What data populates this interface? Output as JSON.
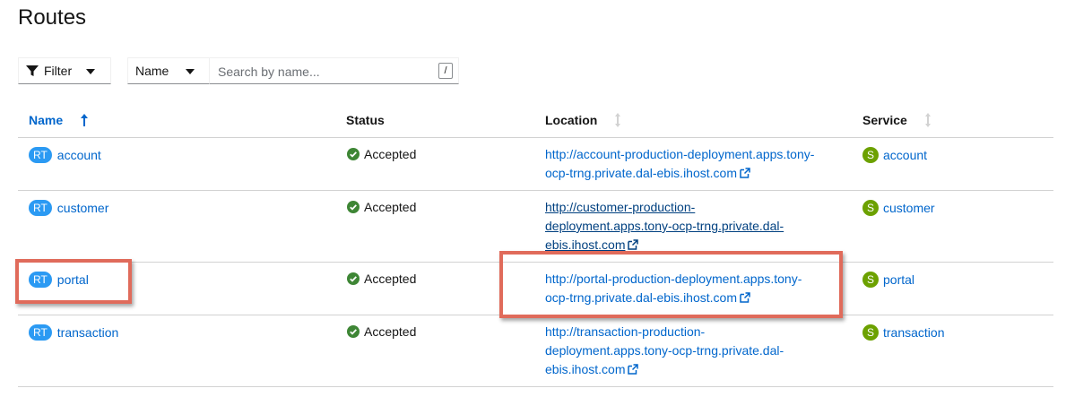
{
  "page": {
    "title": "Routes"
  },
  "toolbar": {
    "filter_label": "Filter",
    "attribute_label": "Name",
    "search_placeholder": "Search by name...",
    "shortcut": "/"
  },
  "table": {
    "columns": {
      "name": "Name",
      "status": "Status",
      "location": "Location",
      "service": "Service"
    },
    "rows": [
      {
        "badge": "RT",
        "name": "account",
        "status": "Accepted",
        "location_lines": [
          "http://account-production-deployment.apps.tony-",
          "ocp-trng.private.dal-ebis.ihost.com"
        ],
        "service_badge": "S",
        "service": "account"
      },
      {
        "badge": "RT",
        "name": "customer",
        "status": "Accepted",
        "location_lines": [
          "http://customer-production-",
          "deployment.apps.tony-ocp-trng.private.dal-",
          "ebis.ihost.com"
        ],
        "service_badge": "S",
        "service": "customer"
      },
      {
        "badge": "RT",
        "name": "portal",
        "status": "Accepted",
        "location_lines": [
          "http://portal-production-deployment.apps.tony-",
          "ocp-trng.private.dal-ebis.ihost.com"
        ],
        "service_badge": "S",
        "service": "portal"
      },
      {
        "badge": "RT",
        "name": "transaction",
        "status": "Accepted",
        "location_lines": [
          "http://transaction-production-",
          "deployment.apps.tony-ocp-trng.private.dal-",
          "ebis.ihost.com"
        ],
        "service_badge": "S",
        "service": "transaction"
      }
    ]
  },
  "colors": {
    "link": "#0066cc",
    "route_badge": "#2b9af3",
    "service_badge": "#6ca100",
    "success": "#3e8635",
    "highlight": "#e06b5b"
  }
}
